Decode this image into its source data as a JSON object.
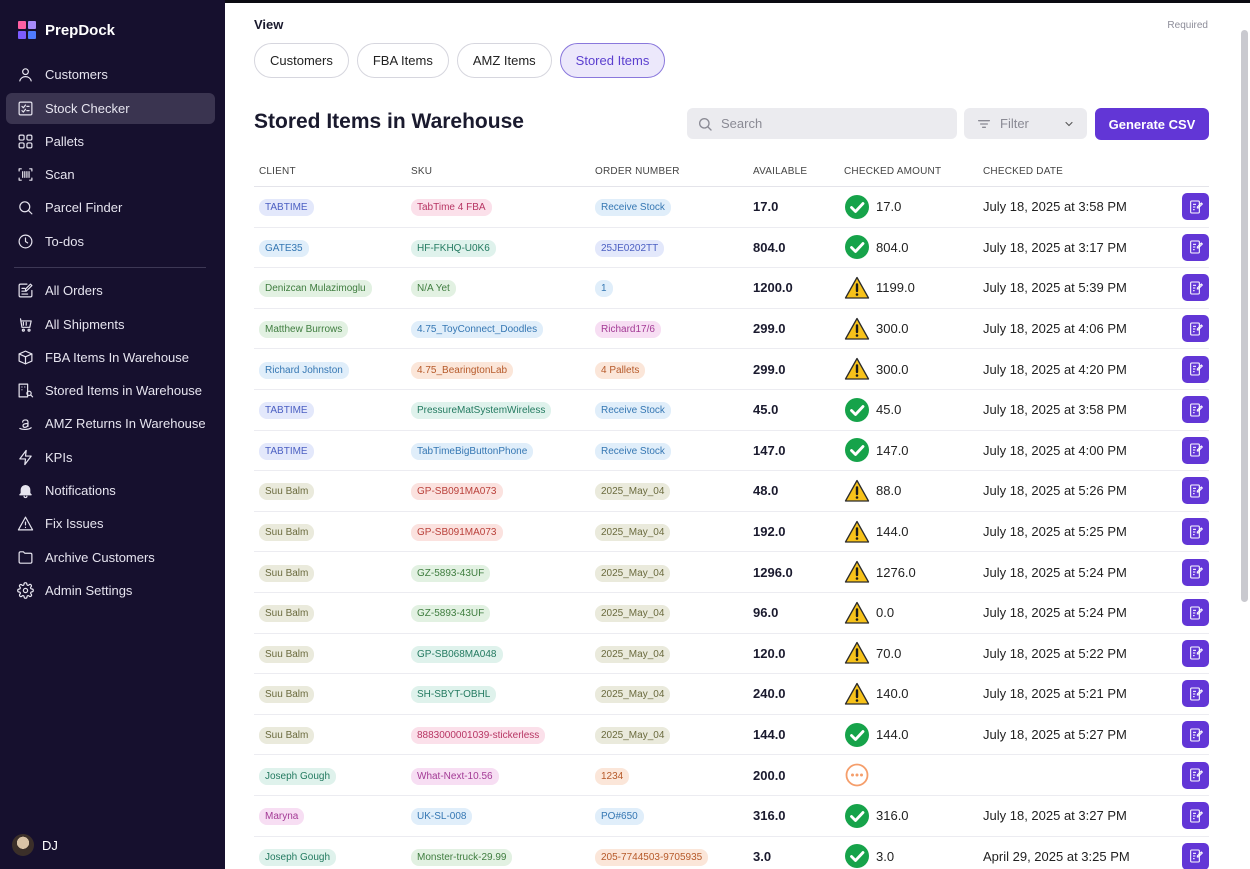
{
  "app": {
    "name": "PrepDock"
  },
  "sidebar": {
    "items": [
      {
        "label": "Customers",
        "icon": "user-icon"
      },
      {
        "label": "Stock Checker",
        "icon": "checklist-icon",
        "active": true
      },
      {
        "label": "Pallets",
        "icon": "grid-icon"
      },
      {
        "label": "Scan",
        "icon": "barcode-scan-icon"
      },
      {
        "label": "Parcel Finder",
        "icon": "search-icon"
      },
      {
        "label": "To-dos",
        "icon": "clock-icon"
      },
      {
        "label": "All Orders",
        "icon": "edit-list-icon"
      },
      {
        "label": "All Shipments",
        "icon": "cart-icon"
      },
      {
        "label": "FBA Items In Warehouse",
        "icon": "box-icon"
      },
      {
        "label": "Stored Items in Warehouse",
        "icon": "building-search-icon"
      },
      {
        "label": "AMZ Returns In Warehouse",
        "icon": "amazon-icon"
      },
      {
        "label": "KPIs",
        "icon": "bolt-icon"
      },
      {
        "label": "Notifications",
        "icon": "bell-icon"
      },
      {
        "label": "Fix Issues",
        "icon": "warning-icon"
      },
      {
        "label": "Archive Customers",
        "icon": "folder-icon"
      },
      {
        "label": "Admin Settings",
        "icon": "gear-icon"
      }
    ],
    "user": {
      "initials": "DJ"
    }
  },
  "view": {
    "label": "View",
    "required": "Required",
    "tabs": [
      {
        "label": "Customers"
      },
      {
        "label": "FBA Items"
      },
      {
        "label": "AMZ Items"
      },
      {
        "label": "Stored Items",
        "active": true
      }
    ]
  },
  "main": {
    "title": "Stored Items in Warehouse",
    "search_placeholder": "Search",
    "filter_label": "Filter",
    "csv_label": "Generate CSV"
  },
  "table": {
    "columns": [
      "CLIENT",
      "SKU",
      "ORDER NUMBER",
      "AVAILABLE",
      "CHECKED AMOUNT",
      "CHECKED DATE"
    ],
    "rows": [
      {
        "client": "TABTIME",
        "client_color": "blue",
        "sku": "TabTime 4 FBA",
        "sku_color": "pink",
        "order": "Receive Stock",
        "order_color": "lightblue",
        "available": "17.0",
        "status": "ok",
        "checked": "17.0",
        "date": "July 18, 2025 at 3:58 PM"
      },
      {
        "client": "GATE35",
        "client_color": "lightblue",
        "sku": "HF-FKHQ-U0K6",
        "sku_color": "teal",
        "order": "25JE0202TT",
        "order_color": "blue",
        "available": "804.0",
        "status": "ok",
        "checked": "804.0",
        "date": "July 18, 2025 at 3:17 PM"
      },
      {
        "client": "Denizcan Mulazimoglu",
        "client_color": "green",
        "sku": "N/A Yet",
        "sku_color": "green",
        "order": "1",
        "order_color": "lightblue",
        "available": "1200.0",
        "status": "warn",
        "checked": "1199.0",
        "date": "July 18, 2025 at 5:39 PM"
      },
      {
        "client": "Matthew Burrows",
        "client_color": "green",
        "sku": "4.75_ToyConnect_Doodles",
        "sku_color": "lightblue",
        "order": "Richard17/6",
        "order_color": "magenta",
        "available": "299.0",
        "status": "warn",
        "checked": "300.0",
        "date": "July 18, 2025 at 4:06 PM"
      },
      {
        "client": "Richard Johnston",
        "client_color": "lightblue",
        "sku": "4.75_BearingtonLab",
        "sku_color": "orange",
        "order": "4 Pallets",
        "order_color": "orange",
        "available": "299.0",
        "status": "warn",
        "checked": "300.0",
        "date": "July 18, 2025 at 4:20 PM"
      },
      {
        "client": "TABTIME",
        "client_color": "blue",
        "sku": "PressureMatSystemWireless",
        "sku_color": "teal",
        "order": "Receive Stock",
        "order_color": "lightblue",
        "available": "45.0",
        "status": "ok",
        "checked": "45.0",
        "date": "July 18, 2025 at 3:58 PM"
      },
      {
        "client": "TABTIME",
        "client_color": "blue",
        "sku": "TabTimeBigButtonPhone",
        "sku_color": "lightblue",
        "order": "Receive Stock",
        "order_color": "lightblue",
        "available": "147.0",
        "status": "ok",
        "checked": "147.0",
        "date": "July 18, 2025 at 4:00 PM"
      },
      {
        "client": "Suu Balm",
        "client_color": "olive",
        "sku": "GP-SB091MA073",
        "sku_color": "red",
        "order": "2025_May_04",
        "order_color": "olive",
        "available": "48.0",
        "status": "warn",
        "checked": "88.0",
        "date": "July 18, 2025 at 5:26 PM"
      },
      {
        "client": "Suu Balm",
        "client_color": "olive",
        "sku": "GP-SB091MA073",
        "sku_color": "red",
        "order": "2025_May_04",
        "order_color": "olive",
        "available": "192.0",
        "status": "warn",
        "checked": "144.0",
        "date": "July 18, 2025 at 5:25 PM"
      },
      {
        "client": "Suu Balm",
        "client_color": "olive",
        "sku": "GZ-5893-43UF",
        "sku_color": "green",
        "order": "2025_May_04",
        "order_color": "olive",
        "available": "1296.0",
        "status": "warn",
        "checked": "1276.0",
        "date": "July 18, 2025 at 5:24 PM"
      },
      {
        "client": "Suu Balm",
        "client_color": "olive",
        "sku": "GZ-5893-43UF",
        "sku_color": "green",
        "order": "2025_May_04",
        "order_color": "olive",
        "available": "96.0",
        "status": "warn",
        "checked": "0.0",
        "date": "July 18, 2025 at 5:24 PM"
      },
      {
        "client": "Suu Balm",
        "client_color": "olive",
        "sku": "GP-SB068MA048",
        "sku_color": "teal",
        "order": "2025_May_04",
        "order_color": "olive",
        "available": "120.0",
        "status": "warn",
        "checked": "70.0",
        "date": "July 18, 2025 at 5:22 PM"
      },
      {
        "client": "Suu Balm",
        "client_color": "olive",
        "sku": "SH-SBYT-OBHL",
        "sku_color": "teal",
        "order": "2025_May_04",
        "order_color": "olive",
        "available": "240.0",
        "status": "warn",
        "checked": "140.0",
        "date": "July 18, 2025 at 5:21 PM"
      },
      {
        "client": "Suu Balm",
        "client_color": "olive",
        "sku": "8883000001039-stickerless",
        "sku_color": "pink",
        "order": "2025_May_04",
        "order_color": "olive",
        "available": "144.0",
        "status": "ok",
        "checked": "144.0",
        "date": "July 18, 2025 at 5:27 PM"
      },
      {
        "client": "Joseph Gough",
        "client_color": "teal",
        "sku": "What-Next-10.56",
        "sku_color": "magenta",
        "order": "1234",
        "order_color": "orange",
        "available": "200.0",
        "status": "pending",
        "checked": "",
        "date": ""
      },
      {
        "client": "Maryna",
        "client_color": "magenta",
        "sku": "UK-SL-008",
        "sku_color": "lightblue",
        "order": "PO#650",
        "order_color": "lightblue",
        "available": "316.0",
        "status": "ok",
        "checked": "316.0",
        "date": "July 18, 2025 at 3:27 PM"
      },
      {
        "client": "Joseph Gough",
        "client_color": "teal",
        "sku": "Monster-truck-29.99",
        "sku_color": "green",
        "order": "205-7744503-9705935",
        "order_color": "orange",
        "available": "3.0",
        "status": "ok",
        "checked": "3.0",
        "date": "April 29, 2025 at 3:25 PM"
      }
    ]
  },
  "colors": {
    "sidebar_bg": "#16102e",
    "accent": "#6236d6",
    "ok": "#16a34a",
    "warn": "#f5c518",
    "pending": "#f59e6b"
  }
}
